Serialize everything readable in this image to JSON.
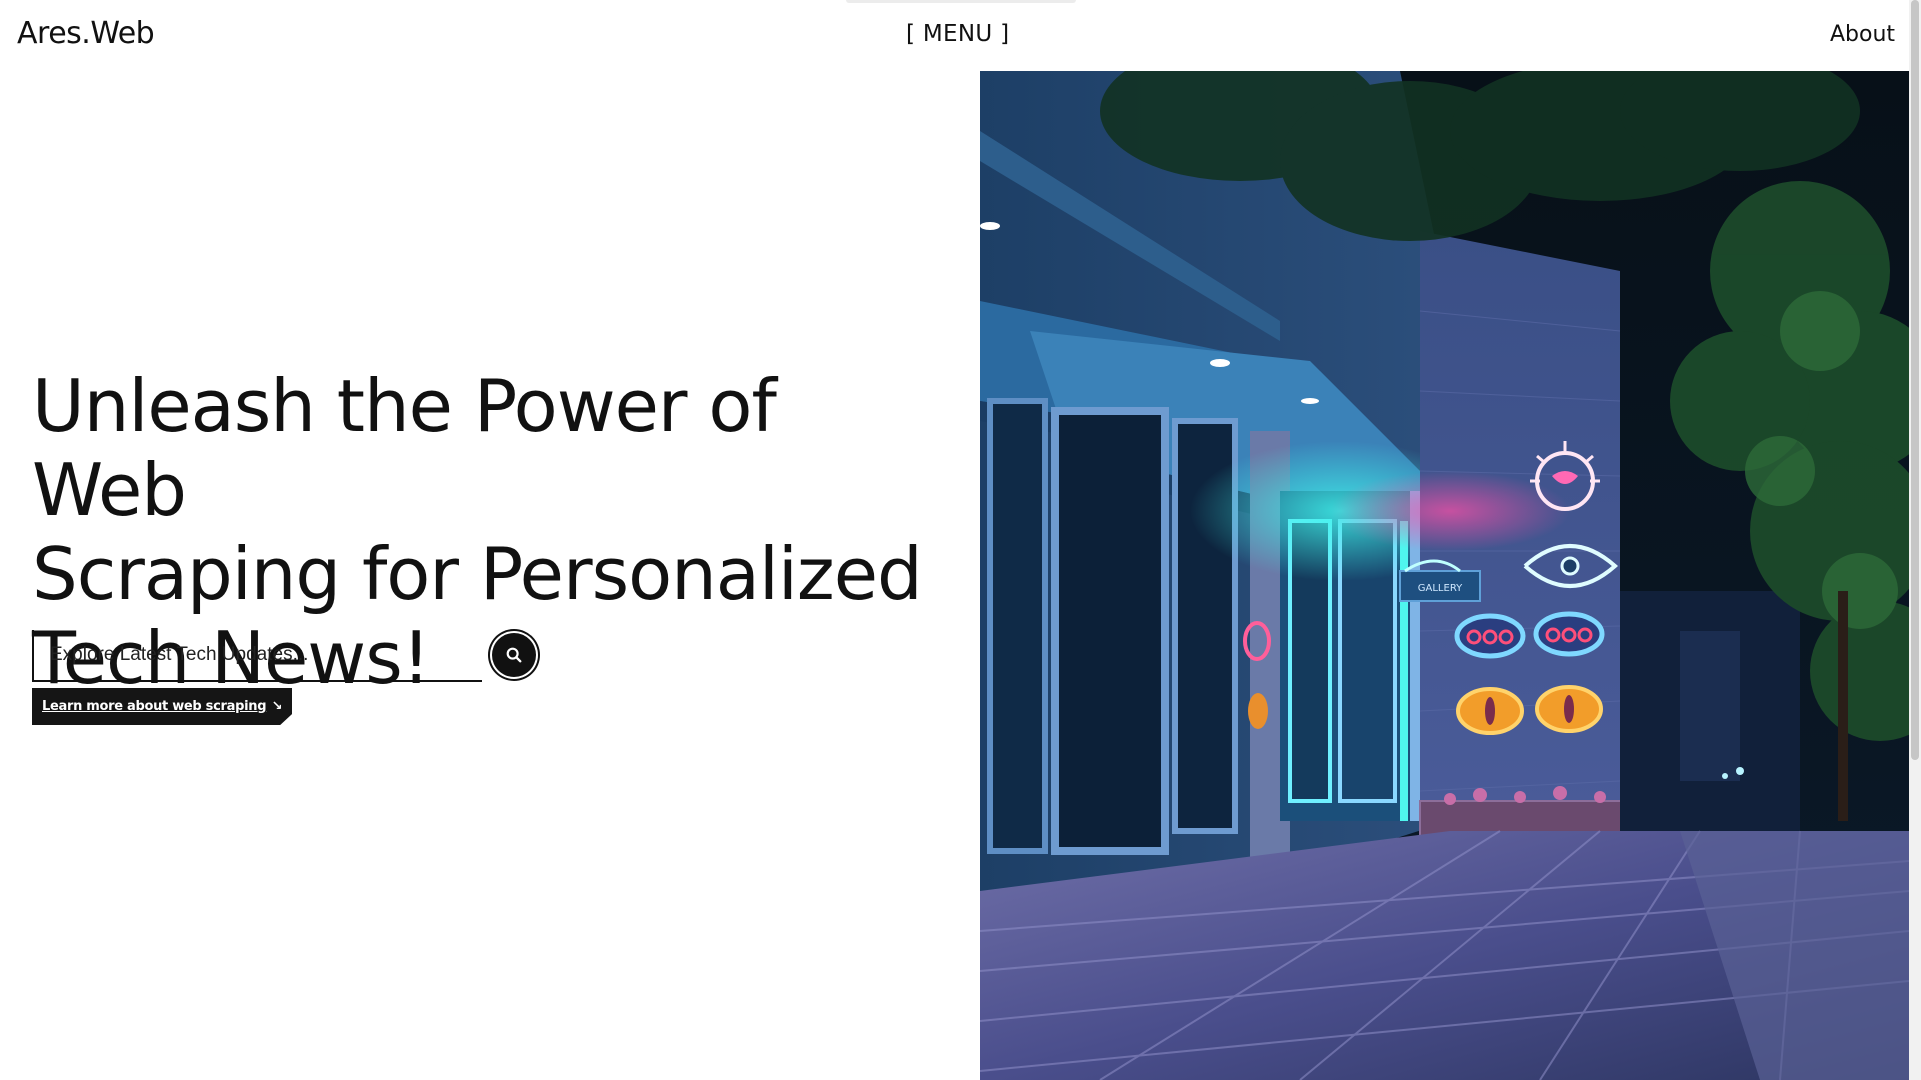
{
  "header": {
    "brand": "Ares.Web",
    "menu_label": "[ MENU ]",
    "about_label": "About"
  },
  "hero": {
    "title_line1": "Unleash the Power of Web",
    "title_line2": "Scraping for Personalized",
    "title_line3": "Tech News!",
    "search_placeholder": "Explore Latest Tech Updates...",
    "learn_more_label": "Learn more about web scraping",
    "learn_more_arrow": "↘",
    "image_sign_text": "GALLERY"
  },
  "icons": {
    "search": "search-icon"
  },
  "colors": {
    "text": "#111111",
    "pill_background": "#151515",
    "background": "#ffffff"
  }
}
